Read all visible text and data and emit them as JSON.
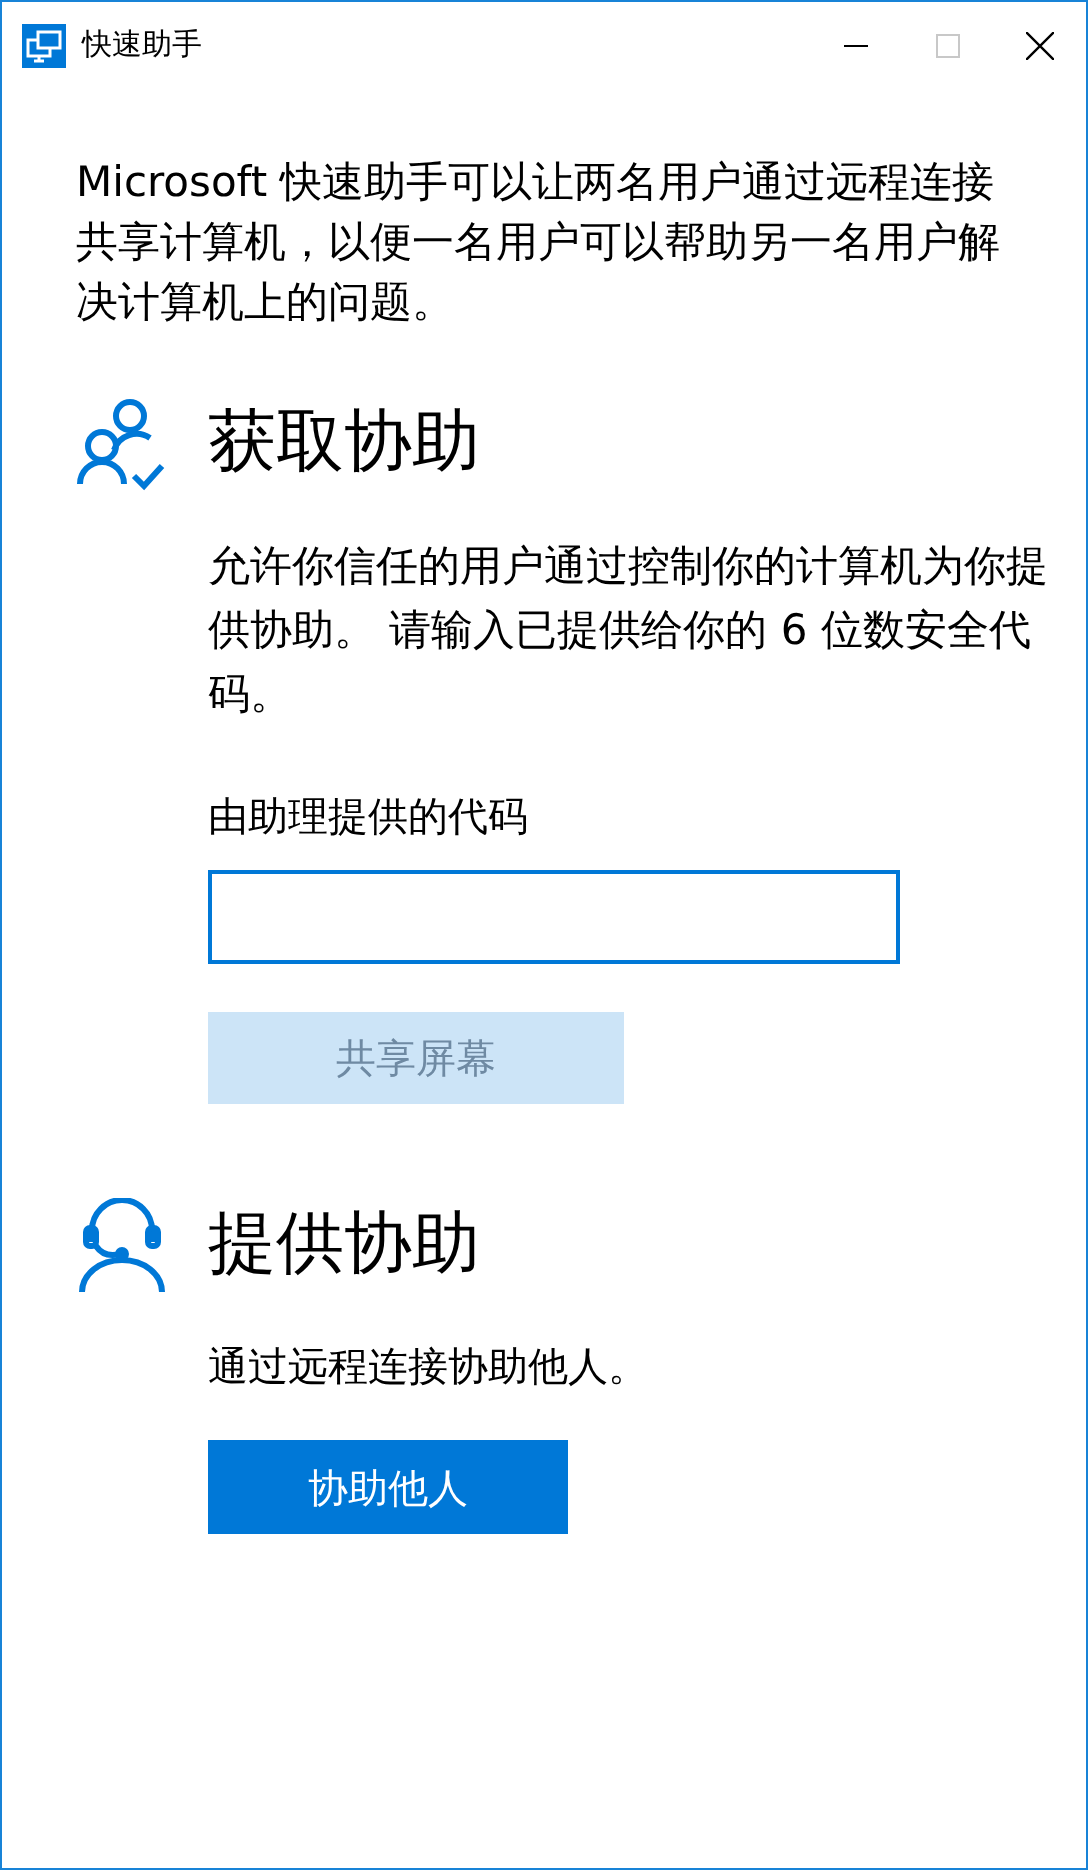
{
  "window": {
    "title": "快速助手",
    "maximize_disabled": true
  },
  "intro": "Microsoft 快速助手可以让两名用户通过远程连接共享计算机，以便一名用户可以帮助另一名用户解决计算机上的问题。",
  "get_help": {
    "heading": "获取协助",
    "description": "允许你信任的用户通过控制你的计算机为你提供协助。 请输入已提供给你的 6 位数安全代码。",
    "field_label": "由助理提供的代码",
    "button": {
      "label": "共享屏幕",
      "disabled": true
    }
  },
  "give_help": {
    "heading": "提供协助",
    "description": "通过远程连接协助他人。",
    "button": {
      "label": "协助他人",
      "disabled": false
    }
  }
}
